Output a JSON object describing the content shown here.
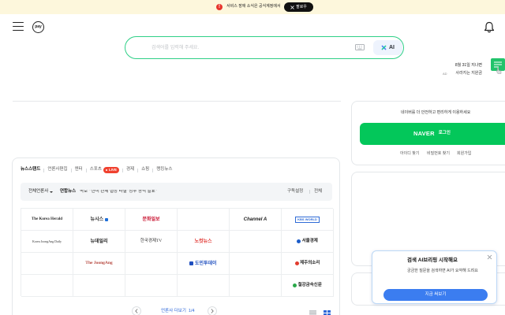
{
  "banner": {
    "text": "서비스 장애 소식은 공식계정에서",
    "button_label": "팔로우"
  },
  "header": {
    "pay_label": "pay"
  },
  "search": {
    "placeholder": "검색어를 입력해 주세요.",
    "ai_label": "AI"
  },
  "promo": {
    "line1": "8월 31일 지나면",
    "ad_label": "AD",
    "line2": "사라지는 지원금"
  },
  "news": {
    "tabs": [
      {
        "label": "뉴스스탠드",
        "active": true
      },
      {
        "label": "언론사편집"
      },
      {
        "label": "엔터"
      },
      {
        "label": "스포츠"
      },
      {
        "label": "경제"
      },
      {
        "label": "쇼핑"
      },
      {
        "label": "랭킹뉴스"
      }
    ],
    "live_badge": "LIVE",
    "filter_label": "전체언론사",
    "press": "연합뉴스",
    "headline": "속보 \"'한미 관세 협상 타결' 정부 공식 발표\"",
    "subscribe_label": "구독설정",
    "all_label": "전체",
    "logos": [
      [
        {
          "name": "The Korea Herald",
          "color": "#2b2b2b"
        },
        {
          "name": "뉴시스",
          "color": "#222222",
          "icon": "blue-square-icon",
          "icon_color": "#1e6fd9"
        },
        {
          "name": "문화일보",
          "color": "#c8102e"
        },
        {
          "name": ""
        },
        {
          "name": "Channel A",
          "color": "#1a1a1a"
        },
        {
          "name": "KBS WORLD",
          "color": "#2f6bd6"
        }
      ],
      [
        {
          "name": "Korea JoongAng Daily",
          "color": "#333333"
        },
        {
          "name": "뉴데일리",
          "color": "#222222"
        },
        {
          "name": "한국경제TV",
          "color": "#333333"
        },
        {
          "name": "노컷뉴스",
          "color": "#e0312c"
        },
        {
          "name": ""
        },
        {
          "name": "서울경제",
          "color": "#222222",
          "icon": "blue-s-circle-icon",
          "icon_color": "#1c5dc9"
        }
      ],
      [
        {
          "name": ""
        },
        {
          "name": "The JoongAng",
          "color": "#b5433a"
        },
        {
          "name": ""
        },
        {
          "name": "도민투데이",
          "color": "#1f4fbf",
          "icon": "blue-leaf-icon",
          "icon_color": "#1f4fbf"
        },
        {
          "name": ""
        },
        {
          "name": "제주의소리",
          "color": "#222222",
          "icon": "red-swirl-icon",
          "icon_color": "#e23b2e"
        }
      ],
      [
        {
          "name": ""
        },
        {
          "name": ""
        },
        {
          "name": ""
        },
        {
          "name": ""
        },
        {
          "name": ""
        },
        {
          "name": "철강금속신문",
          "color": "#222222",
          "icon": "green-circle-icon",
          "icon_color": "#2aa84a"
        }
      ]
    ],
    "pager": {
      "label": "언론사 더보기",
      "page": "1/4"
    }
  },
  "login": {
    "message": "네이버를 더 안전하고 편리하게 이용하세요",
    "brand": "NAVER",
    "button_label": "로그인",
    "links": [
      "아이디 찾기",
      "비밀번호 찾기",
      "회원가입"
    ]
  },
  "popup": {
    "title": "검색 AI브리핑 시작해요",
    "description": "궁금한 질문을 검색하면 AI가 요약해 드려요",
    "button_label": "지금 써보기"
  },
  "colors": {
    "banner_bg": "#fdf7dc",
    "alert_red": "#e7352c",
    "search_border": "#2fd087",
    "brand_green": "#03c75a",
    "live_red": "#f0412f",
    "link_blue": "#2d67d9",
    "popup_border": "#bcd8f6",
    "popup_button": "#3b7df0"
  }
}
